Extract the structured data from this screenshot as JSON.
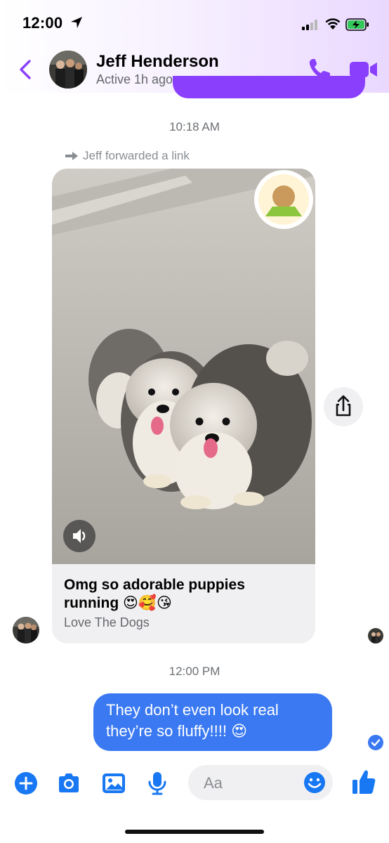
{
  "status_bar": {
    "time": "12:00"
  },
  "header": {
    "contact_name": "Jeff Henderson",
    "contact_status": "Active 1h ago",
    "accent_color": "#8a3ffc"
  },
  "thread": {
    "timestamp_1": "10:18 AM",
    "forward_note": "Jeff forwarded a link",
    "shared_card": {
      "title": "Omg so adorable puppies running 😍🥰😘",
      "source": "Love The Dogs"
    },
    "timestamp_2": "12:00 PM",
    "my_message": "They don’t even look real they’re so fluffy!!!! 😍"
  },
  "composer": {
    "placeholder": "Aa",
    "icons": [
      "plus-icon",
      "camera-icon",
      "image-icon",
      "microphone-icon",
      "emoji-icon",
      "thumbs-up-icon"
    ],
    "icon_color": "#1877f2"
  },
  "colors": {
    "my_bubble": "#3a79f2",
    "card_bg": "#f0f0f2"
  }
}
